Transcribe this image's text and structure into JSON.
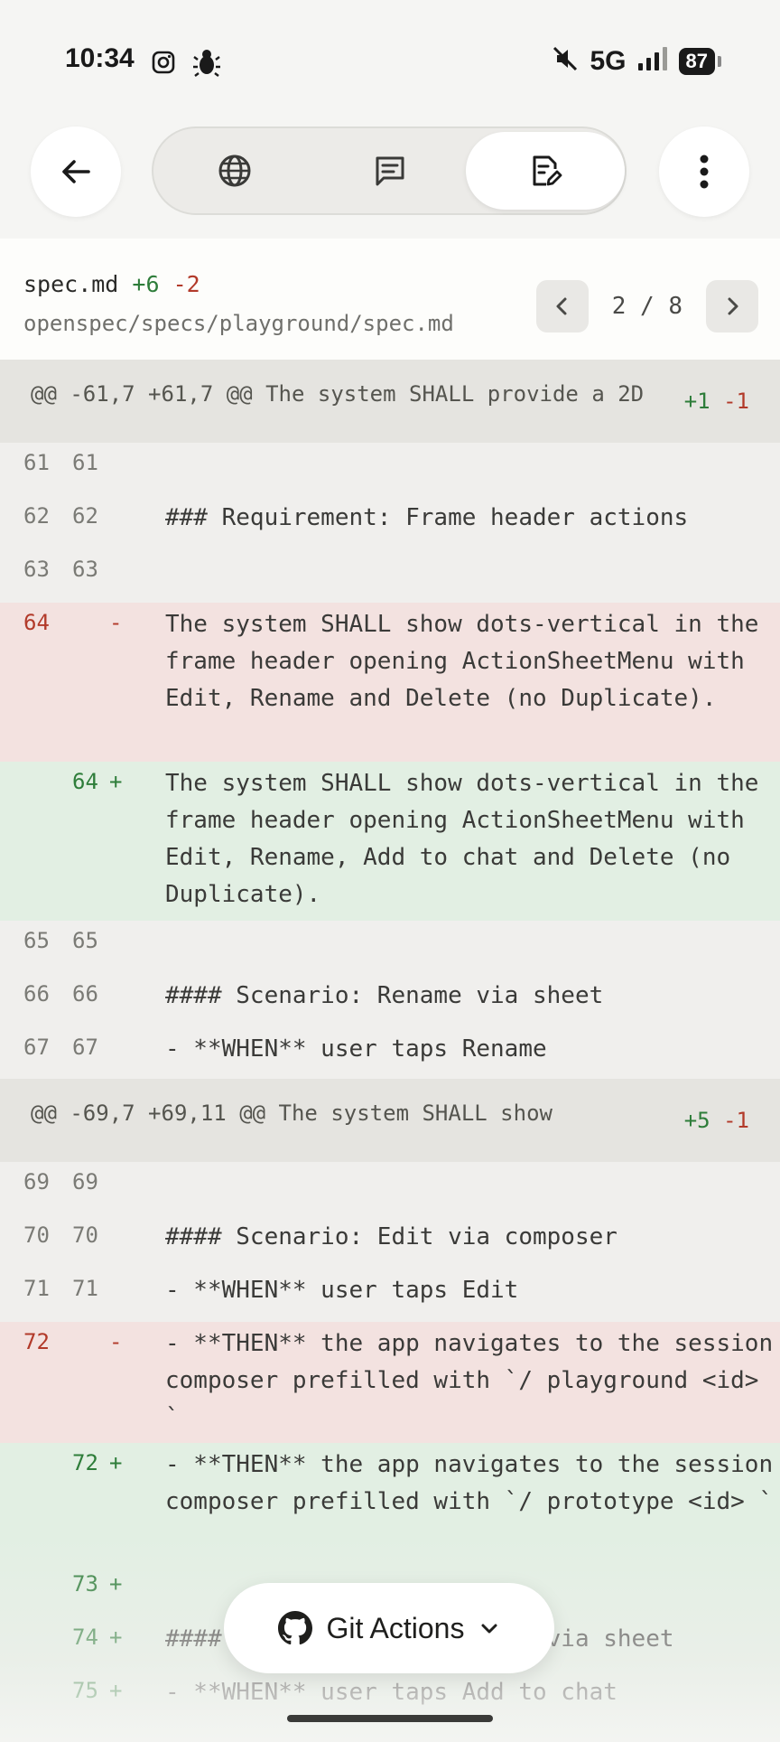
{
  "status_bar": {
    "time": "10:34",
    "network": "5G",
    "battery": "87"
  },
  "file": {
    "name": "spec.md",
    "additions": "+6",
    "deletions": "-2",
    "path": "openspec/specs/playground/spec.md",
    "pager": "2 / 8"
  },
  "hunks": [
    {
      "header": "@@ -61,7 +61,7 @@ The system SHALL provide a 2D",
      "additions": "+1",
      "deletions": "-1",
      "lines": [
        {
          "type": "ctx",
          "old": "61",
          "new": "61",
          "sign": "",
          "text": ""
        },
        {
          "type": "ctx",
          "old": "62",
          "new": "62",
          "sign": "",
          "text": "### Requirement: Frame header actions"
        },
        {
          "type": "ctx",
          "old": "63",
          "new": "63",
          "sign": "",
          "text": ""
        },
        {
          "type": "del",
          "old": "64",
          "new": "",
          "sign": "-",
          "text": "The system SHALL show dots-vertical in the frame header opening ActionSheetMenu with Edit, Rename and Delete (no Duplicate)."
        },
        {
          "type": "add",
          "old": "",
          "new": "64",
          "sign": "+",
          "text": "The system SHALL show dots-vertical in the frame header opening ActionSheetMenu with Edit, Rename, Add to chat and Delete (no Duplicate)."
        },
        {
          "type": "ctx",
          "old": "65",
          "new": "65",
          "sign": "",
          "text": ""
        },
        {
          "type": "ctx",
          "old": "66",
          "new": "66",
          "sign": "",
          "text": "#### Scenario: Rename via sheet"
        },
        {
          "type": "ctx",
          "old": "67",
          "new": "67",
          "sign": "",
          "text": "- **WHEN** user taps Rename"
        }
      ]
    },
    {
      "header": "@@ -69,7 +69,11 @@ The system SHALL show",
      "additions": "+5",
      "deletions": "-1",
      "lines": [
        {
          "type": "ctx",
          "old": "69",
          "new": "69",
          "sign": "",
          "text": ""
        },
        {
          "type": "ctx",
          "old": "70",
          "new": "70",
          "sign": "",
          "text": "#### Scenario: Edit via composer"
        },
        {
          "type": "ctx",
          "old": "71",
          "new": "71",
          "sign": "",
          "text": "- **WHEN** user taps Edit"
        },
        {
          "type": "del",
          "old": "72",
          "new": "",
          "sign": "-",
          "text": "- **THEN** the app navigates to the session composer prefilled with `/ playground <id> `"
        },
        {
          "type": "add",
          "old": "",
          "new": "72",
          "sign": "+",
          "text": "- **THEN** the app navigates to the session composer prefilled with `/ prototype <id> `"
        },
        {
          "type": "add",
          "old": "",
          "new": "73",
          "sign": "+",
          "text": ""
        },
        {
          "type": "add",
          "old": "",
          "new": "74",
          "sign": "+",
          "text": "#### Scenario: Add to chat via sheet"
        },
        {
          "type": "add",
          "old": "",
          "new": "75",
          "sign": "+",
          "text": "- **WHEN** user taps Add to chat"
        }
      ]
    }
  ],
  "git_actions": {
    "label": "Git Actions"
  },
  "colors": {
    "add": "#2e7d3a",
    "del": "#b23a2a",
    "add_bg": "#e2efe3",
    "del_bg": "#f3e2e0"
  }
}
